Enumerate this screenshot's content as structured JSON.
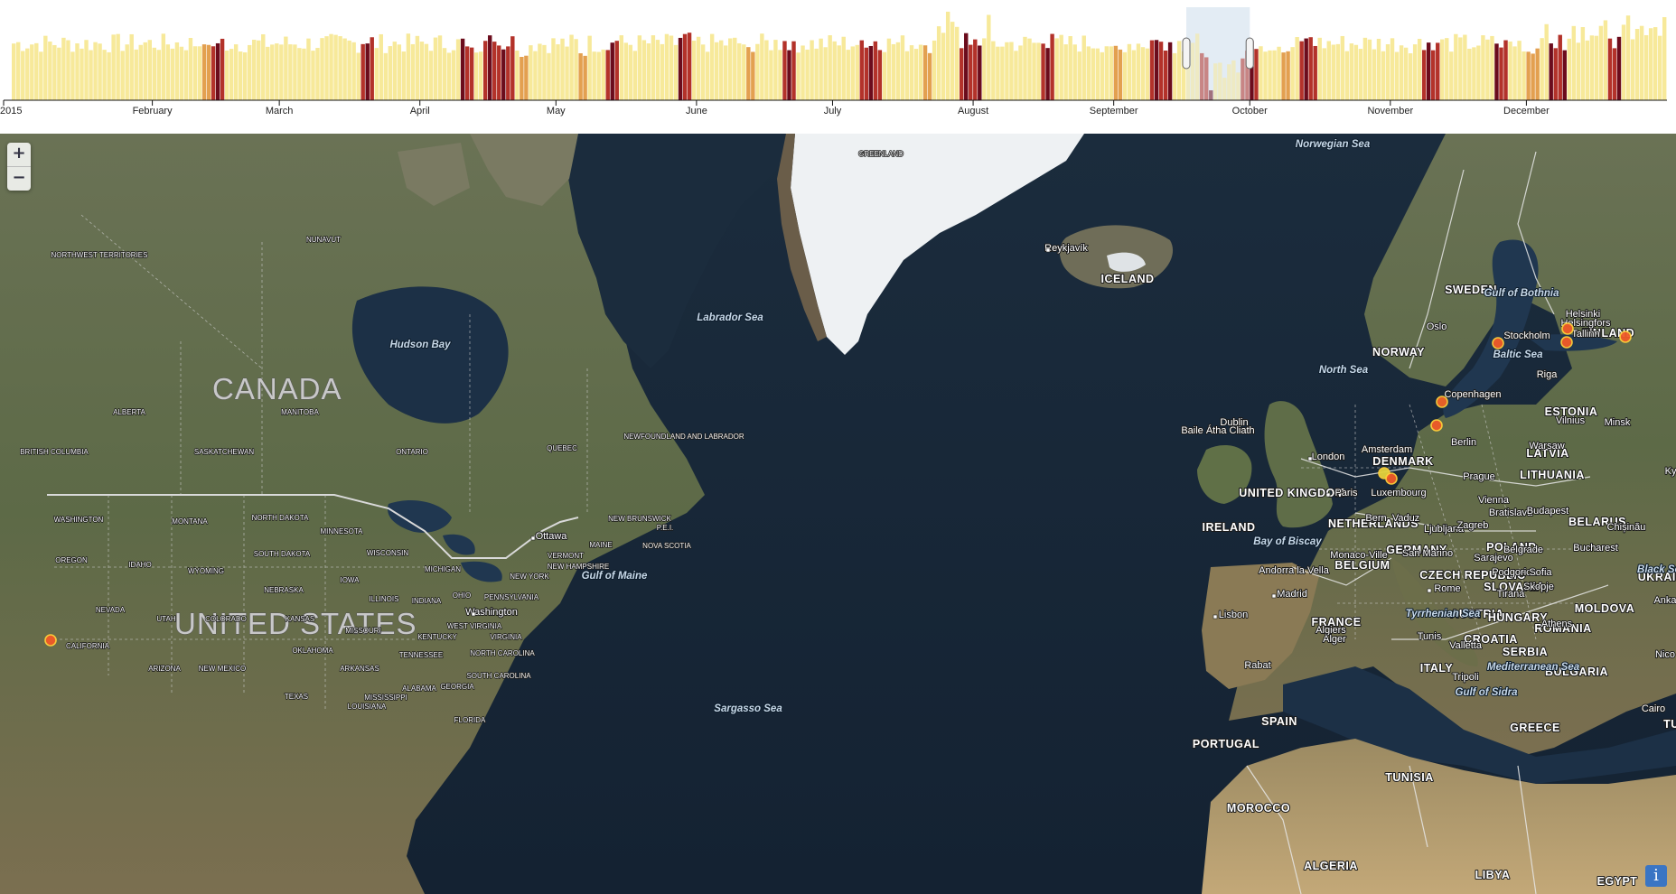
{
  "timeline": {
    "year_label": "2015",
    "months": [
      "February",
      "March",
      "April",
      "May",
      "June",
      "July",
      "August",
      "September",
      "October",
      "November",
      "December"
    ],
    "selection": {
      "from": "2015-09-17",
      "to": "2015-09-30"
    }
  },
  "map": {
    "zoom_in_label": "+",
    "zoom_out_label": "−",
    "info_label": "i",
    "big_labels": [
      "CANADA",
      "UNITED STATES"
    ],
    "country_labels": [
      "ICELAND",
      "SWEDEN",
      "NORWAY",
      "FINLAND",
      "DENMARK",
      "UNITED KINGDOM",
      "IRELAND",
      "GERMANY",
      "POLAND",
      "BELARUS",
      "UKRAINE",
      "FRANCE",
      "SPAIN",
      "PORTUGAL",
      "ITALY",
      "ROMANIA",
      "BULGARIA",
      "GREECE",
      "MOROCCO",
      "ALGERIA",
      "TUNISIA",
      "LIBYA",
      "EGYPT",
      "LATVIA",
      "LITHUANIA",
      "ESTONIA",
      "NETHERLANDS",
      "BELGIUM",
      "CZECH REPUBLIC",
      "SLOVAKIA",
      "AUSTRIA",
      "HUNGARY",
      "CROATIA",
      "SERBIA",
      "MOLDOVA",
      "TU"
    ],
    "state_labels": [
      "NORTHWEST TERRITORIES",
      "NUNAVUT",
      "ALBERTA",
      "MANITOBA",
      "ONTARIO",
      "QUEBEC",
      "BRITISH COLUMBIA",
      "SASKATCHEWAN",
      "NEWFOUNDLAND AND LABRADOR",
      "NEW BRUNSWICK",
      "NOVA SCOTIA",
      "P.E.I.",
      "WASHINGTON",
      "MONTANA",
      "NORTH DAKOTA",
      "MINNESOTA",
      "OREGON",
      "IDAHO",
      "SOUTH DAKOTA",
      "WISCONSIN",
      "WYOMING",
      "MICHIGAN",
      "IOWA",
      "NEBRASKA",
      "NEVADA",
      "UTAH",
      "COLORADO",
      "KANSAS",
      "ILLINOIS",
      "INDIANA",
      "OHIO",
      "PENNSYLVANIA",
      "NEW YORK",
      "VERMONT",
      "MAINE",
      "NEW HAMPSHIRE",
      "CALIFORNIA",
      "MISSOURI",
      "KENTUCKY",
      "WEST VIRGINIA",
      "VIRGINIA",
      "OKLAHOMA",
      "TENNESSEE",
      "NORTH CAROLINA",
      "ARIZONA",
      "NEW MEXICO",
      "ARKANSAS",
      "SOUTH CAROLINA",
      "MISSISSIPPI",
      "ALABAMA",
      "GEORGIA",
      "TEXAS",
      "LOUISIANA",
      "FLORIDA",
      "GREENLAND"
    ],
    "sea_labels": [
      "Norwegian Sea",
      "Labrador Sea",
      "Hudson Bay",
      "North Sea",
      "Gulf of Bothnia",
      "Baltic Sea",
      "Bay of Biscay",
      "Gulf of Maine",
      "Sargasso Sea",
      "Tyrrhenian Sea",
      "Mediterranean Sea",
      "Black Se",
      "Gulf of Sidra"
    ],
    "city_labels": [
      "Reykjavík",
      "Stockholm",
      "Helsinki",
      "Helsingfors",
      "Tallinn",
      "Oslo",
      "Riga",
      "Copenhagen",
      "Dublin",
      "Baile Átha Cliath",
      "London",
      "Amsterdam",
      "Berlin",
      "Warsaw",
      "Minsk",
      "Vilnius",
      "Kyiv",
      "Paris",
      "Luxembourg",
      "Prague",
      "Vienna",
      "Bratislava",
      "Budapest",
      "Bern",
      "Vaduz",
      "Ljubljana",
      "Zagreb",
      "Chișinău",
      "Monaco-Ville",
      "San Marino",
      "Sarajevo",
      "Belgrade",
      "Bucharest",
      "Andorra la Vella",
      "Madrid",
      "Rome",
      "Podgorica",
      "Sofia",
      "Skopje",
      "Tirana",
      "Athens",
      "Lisbon",
      "Algiers",
      "Alger",
      "Tunis",
      "Valletta",
      "Rabat",
      "Tripoli",
      "Cairo",
      "Ottawa",
      "Washington",
      "Anka",
      "Nico"
    ],
    "event_markers": [
      {
        "place": "Oregon",
        "color": "#f05a28"
      },
      {
        "place": "Stockholm",
        "color": "#f05a28"
      },
      {
        "place": "Helsinki",
        "color": "#f05a28"
      },
      {
        "place": "Tallinn",
        "color": "#f05a28"
      },
      {
        "place": "Eastern Finland",
        "color": "#f05a28"
      },
      {
        "place": "Copenhagen",
        "color": "#f06428"
      },
      {
        "place": "Southern Sweden",
        "color": "#f05a28"
      },
      {
        "place": "Germany (west)",
        "color": "#e4d23c"
      },
      {
        "place": "Luxembourg",
        "color": "#f05a28"
      }
    ]
  },
  "colors": {
    "bar_low": "#f7e99a",
    "bar_mid": "#e3a050",
    "bar_high": "#b3322a",
    "bar_max": "#6b0c1c",
    "selection": "#c8daea",
    "marker": "#f05a28"
  }
}
